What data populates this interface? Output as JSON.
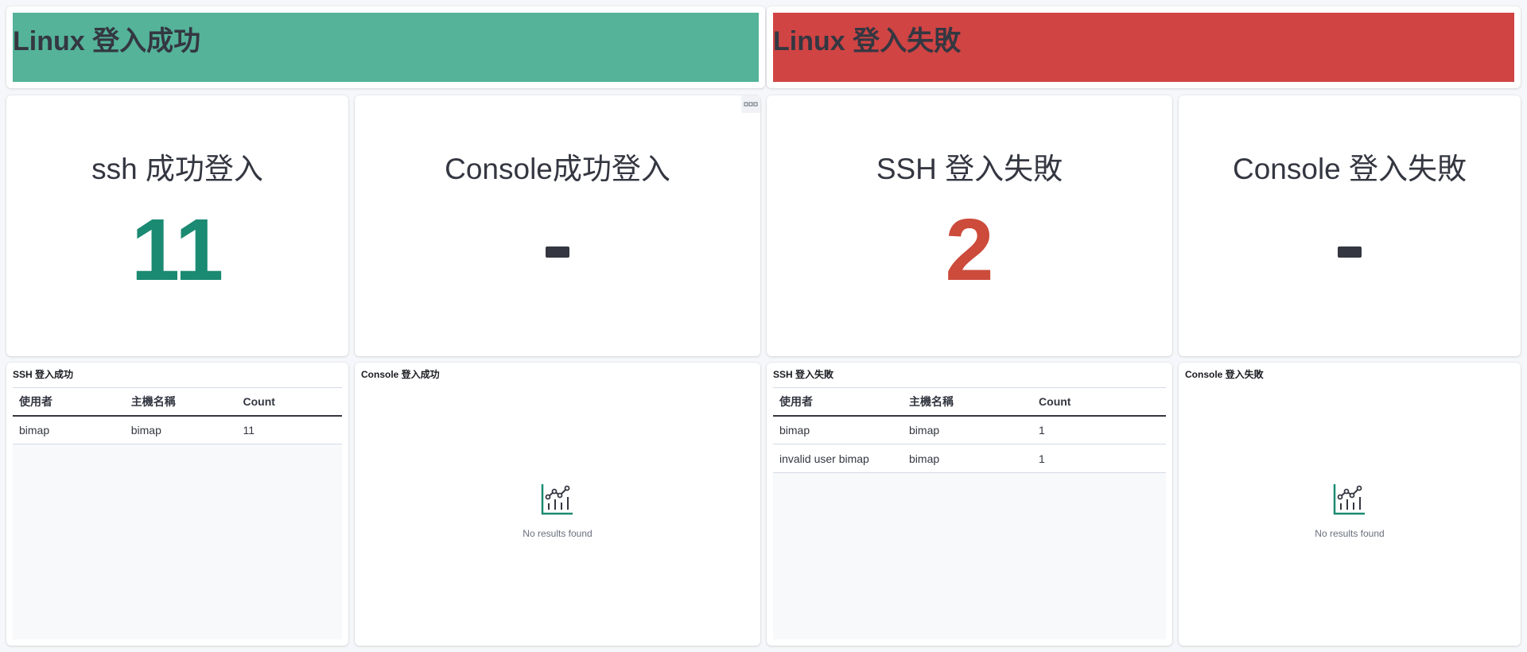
{
  "colors": {
    "success": "#54b399",
    "danger": "#d04444",
    "success_text": "#1b8a72",
    "danger_text": "#cc4b3b",
    "dash": "#343741"
  },
  "banners": {
    "success": {
      "title": "Linux 登入成功"
    },
    "failure": {
      "title": "Linux 登入失敗"
    }
  },
  "metrics": {
    "ssh_success": {
      "label": "ssh 成功登入",
      "value": "11"
    },
    "console_success": {
      "label": "Console成功登入",
      "value": "-"
    },
    "ssh_failure": {
      "label": "SSH 登入失敗",
      "value": "2"
    },
    "console_failure": {
      "label": "Console 登入失敗",
      "value": "-"
    }
  },
  "panel_menu_icon": "more-icon",
  "tables": {
    "ssh_success": {
      "title": "SSH 登入成功",
      "columns": [
        "使用者",
        "主機名稱",
        "Count"
      ],
      "rows": [
        [
          "bimap",
          "bimap",
          "11"
        ]
      ]
    },
    "ssh_failure": {
      "title": "SSH 登入失敗",
      "columns": [
        "使用者",
        "主機名稱",
        "Count"
      ],
      "rows": [
        [
          "bimap",
          "bimap",
          "1"
        ],
        [
          "invalid user bimap",
          "bimap",
          "1"
        ]
      ]
    }
  },
  "empty_panels": {
    "console_success": {
      "title": "Console 登入成功",
      "message": "No results found",
      "icon": "chart-icon"
    },
    "console_failure": {
      "title": "Console 登入失敗",
      "message": "No results found",
      "icon": "chart-icon"
    }
  }
}
